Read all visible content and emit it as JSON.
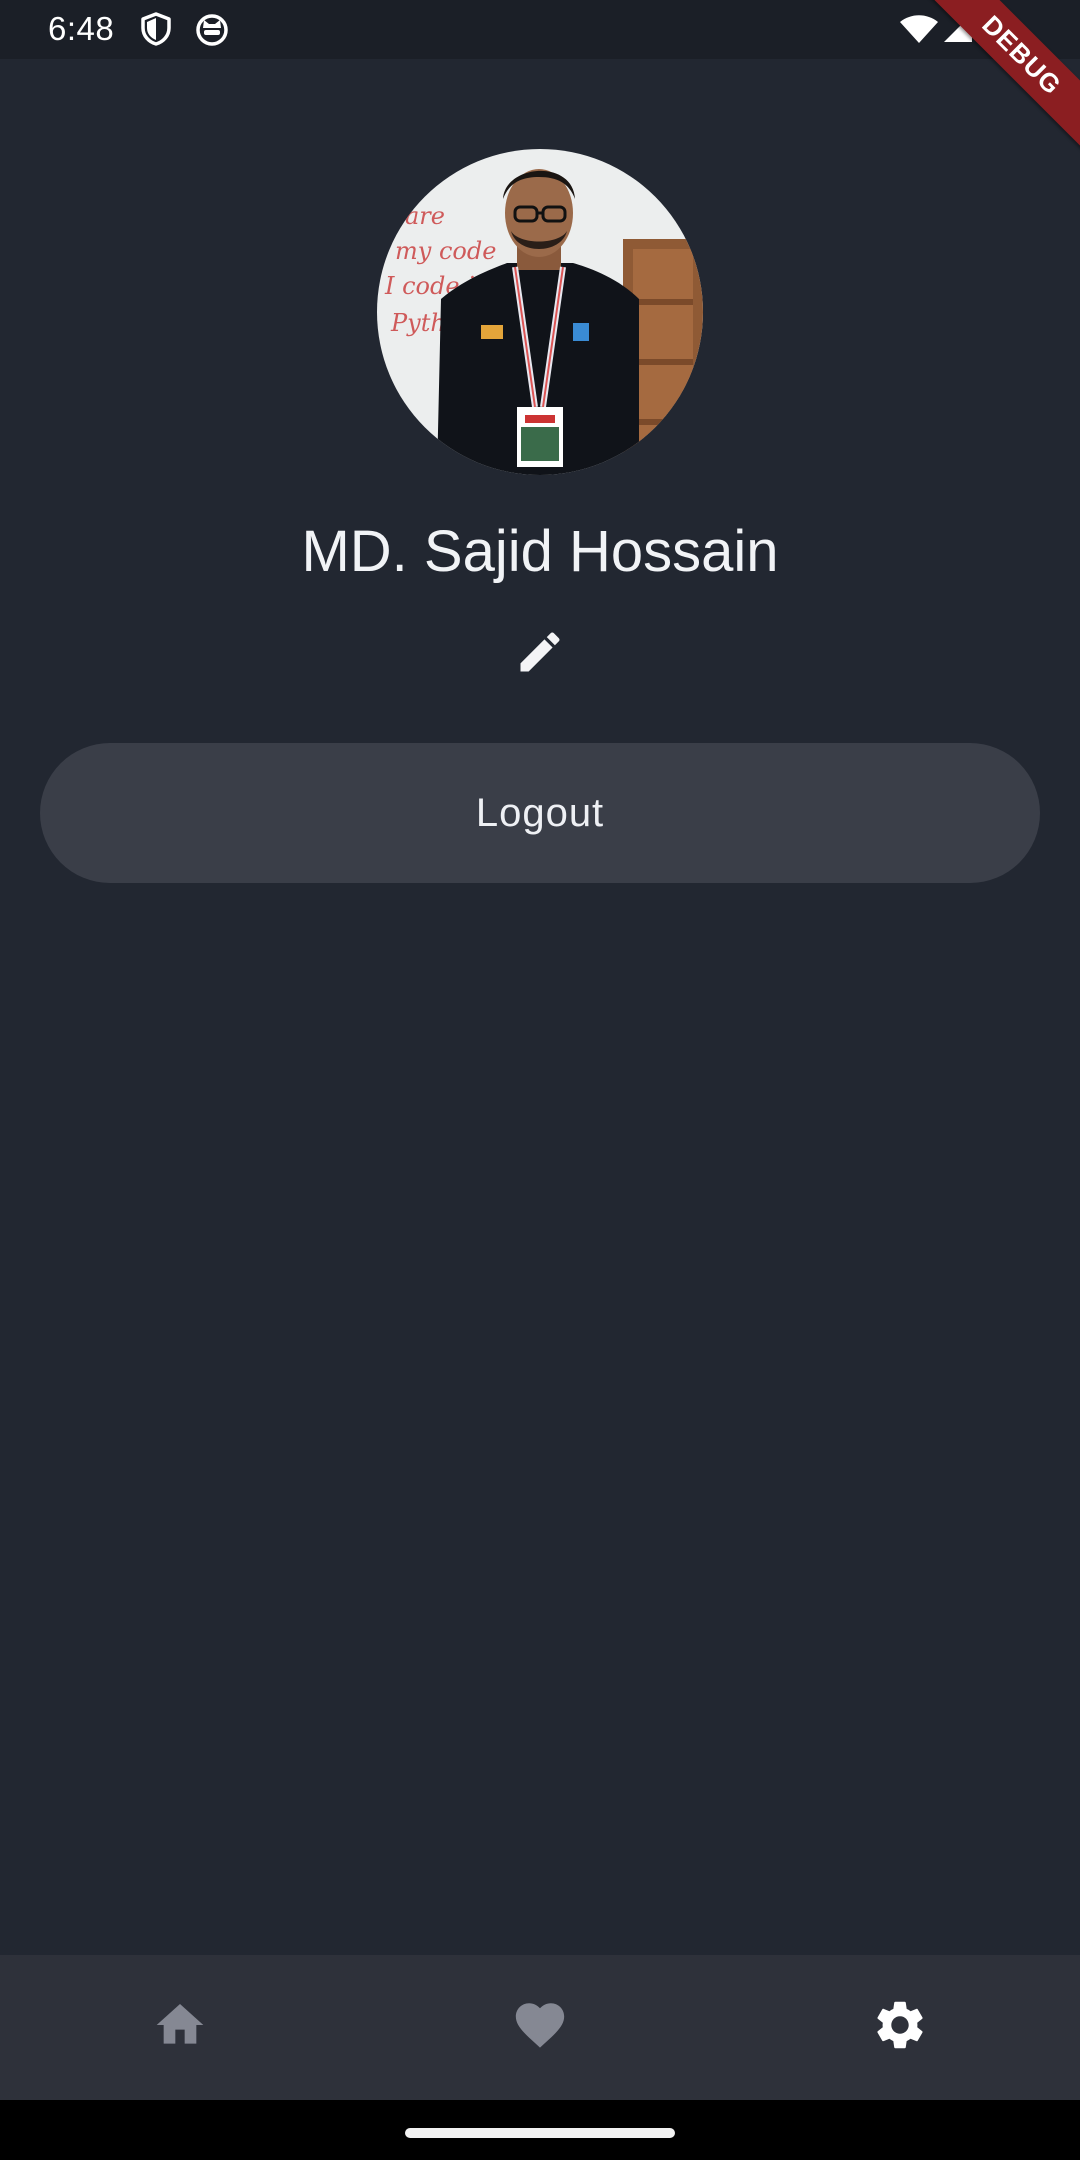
{
  "status_bar": {
    "time": "6:48",
    "icons_left": [
      "shield-icon",
      "cat-icon"
    ],
    "icons_right": [
      "wifi-icon",
      "signal-icon",
      "battery-icon"
    ]
  },
  "debug_banner": {
    "label": "DEBUG"
  },
  "profile": {
    "name": "MD. Sajid Hossain",
    "avatar_icon": "profile-photo",
    "edit_icon": "pencil-icon"
  },
  "actions": {
    "logout_label": "Logout"
  },
  "bottom_nav": {
    "items": [
      {
        "name": "home",
        "icon": "home-icon",
        "active": false
      },
      {
        "name": "favorites",
        "icon": "heart-icon",
        "active": false
      },
      {
        "name": "settings",
        "icon": "gear-icon",
        "active": true
      }
    ]
  },
  "colors": {
    "background": "#222731",
    "status_bar": "#1b1f27",
    "button": "#3a3e48",
    "nav_bar": "#2e313a",
    "debug_ribbon": "#8b1e21",
    "nav_inactive": "#858893",
    "nav_active": "#ffffff"
  }
}
